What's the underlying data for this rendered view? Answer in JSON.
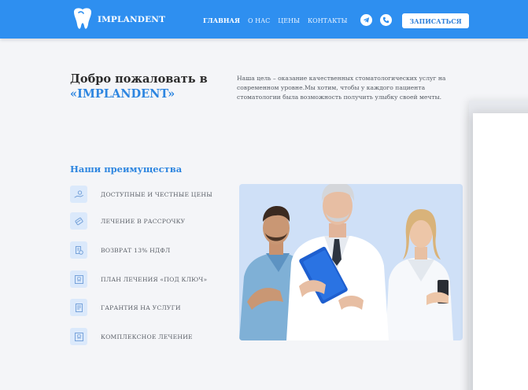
{
  "header": {
    "logo_text": "IMPLANDENT",
    "logo_icon": "tooth-icon",
    "nav": [
      {
        "label": "ГЛАВНАЯ",
        "active": true
      },
      {
        "label": "О НАС",
        "active": false
      },
      {
        "label": "ЦЕНЫ",
        "active": false
      },
      {
        "label": "КОНТАКТЫ",
        "active": false
      }
    ],
    "telegram_icon": "telegram-icon",
    "phone_icon": "phone-icon",
    "cta_label": "ЗАПИСАТЬСЯ"
  },
  "hero": {
    "title_line1": "Добро пожаловать в",
    "title_brand": "«IMPLANDENT»",
    "description": "Наша цель – оказание качественных стоматологических услуг на современном уровне.Мы хотим, чтобы у каждого пациента стоматологии была возможность получить улыбку своей мечты."
  },
  "advantages": {
    "title": "Наши преимущества",
    "items": [
      {
        "label": "ДОСТУПНЫЕ И ЧЕСТНЫЕ ЦЕНЫ",
        "icon": "hand-coins-icon"
      },
      {
        "label": "ЛЕЧЕНИЕ В РАССРОЧКУ",
        "icon": "card-icon"
      },
      {
        "label": "ВОЗВРАТ 13% НДФЛ",
        "icon": "document-refund-icon"
      },
      {
        "label": "ПЛАН ЛЕЧЕНИЯ «ПОД КЛЮЧ»",
        "icon": "tooth-plan-icon"
      },
      {
        "label": "ГАРАНТИЯ НА УСЛУГИ",
        "icon": "guarantee-document-icon"
      },
      {
        "label": "КОМПЛЕКСНОЕ ЛЕЧЕНИЕ",
        "icon": "tooth-complex-icon"
      }
    ]
  },
  "colors": {
    "brand_blue": "#2e8ff0",
    "accent_text": "#2e86e0",
    "icon_bg": "#dbe9fb",
    "photo_bg": "#cfe0f7"
  }
}
